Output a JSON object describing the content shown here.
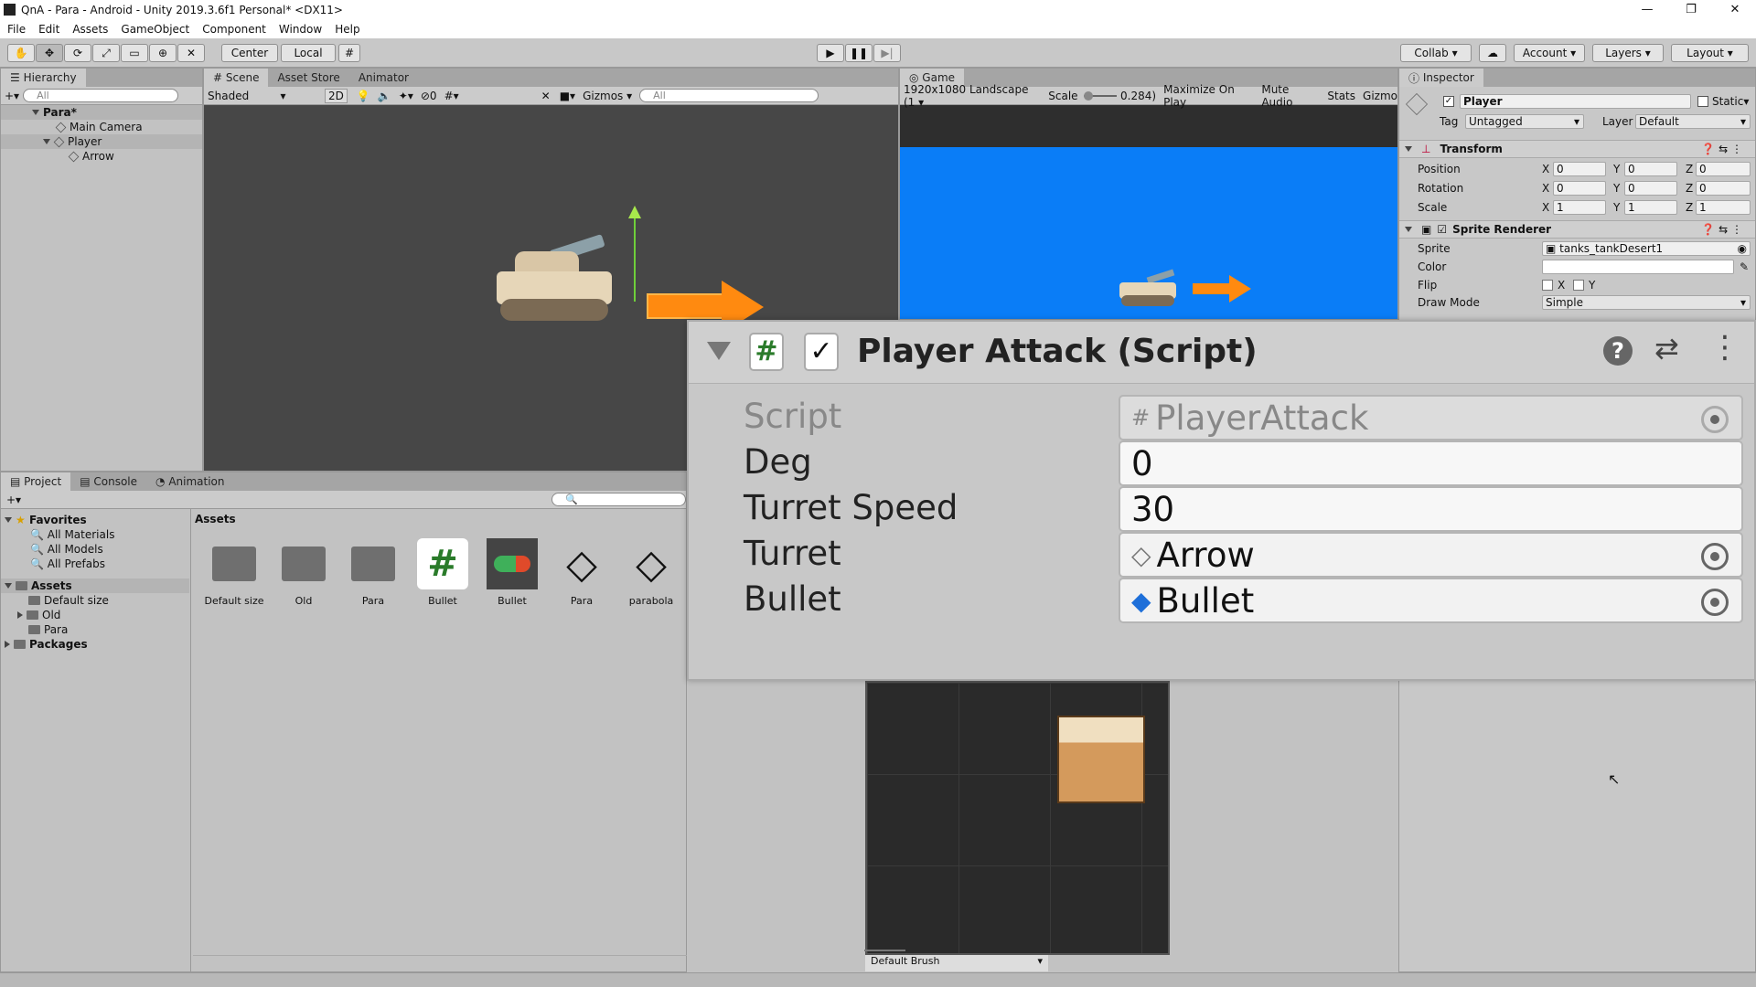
{
  "window": {
    "title": "QnA - Para - Android - Unity 2019.3.6f1 Personal* <DX11>"
  },
  "menu": [
    "File",
    "Edit",
    "Assets",
    "GameObject",
    "Component",
    "Window",
    "Help"
  ],
  "toolbar": {
    "pivot": "Center",
    "space": "Local",
    "collab": "Collab ▾",
    "account": "Account",
    "layers": "Layers",
    "layout": "Layout"
  },
  "hierarchy": {
    "tab": "Hierarchy",
    "search_placeholder": "All",
    "items": [
      "Para*",
      "Main Camera",
      "Player",
      "Arrow"
    ]
  },
  "scene": {
    "tabs": [
      "Scene",
      "Asset Store",
      "Animator"
    ],
    "shading": "Shaded",
    "mode2d": "2D",
    "hidden_count": "0",
    "gizmos": "Gizmos",
    "search_placeholder": "All"
  },
  "game": {
    "tab": "Game",
    "resolution": "1920x1080 Landscape (1",
    "scale_label": "Scale",
    "scale_value": "0.284)",
    "maximize": "Maximize On Play",
    "mute": "Mute Audio",
    "stats": "Stats",
    "gizmos": "Gizmo",
    "bg_color": "#0a7df7"
  },
  "inspector": {
    "tab": "Inspector",
    "object_name": "Player",
    "static": "Static",
    "tag_label": "Tag",
    "tag_value": "Untagged",
    "layer_label": "Layer",
    "layer_value": "Default",
    "transform": {
      "title": "Transform",
      "rows": [
        {
          "label": "Position",
          "x": "0",
          "y": "0",
          "z": "0"
        },
        {
          "label": "Rotation",
          "x": "0",
          "y": "0",
          "z": "0"
        },
        {
          "label": "Scale",
          "x": "1",
          "y": "1",
          "z": "1"
        }
      ]
    },
    "sprite_renderer": {
      "title": "Sprite Renderer",
      "sprite_label": "Sprite",
      "sprite_value": "tanks_tankDesert1",
      "color_label": "Color",
      "flip_label": "Flip",
      "flip_x": "X",
      "flip_y": "Y",
      "draw_mode_label": "Draw Mode",
      "draw_mode_value": "Simple"
    }
  },
  "player_attack": {
    "title": "Player Attack (Script)",
    "script_label": "Script",
    "script_value": "PlayerAttack",
    "deg_label": "Deg",
    "deg_value": "0",
    "turret_speed_label": "Turret Speed",
    "turret_speed_value": "30",
    "turret_label": "Turret",
    "turret_value": "Arrow",
    "bullet_label": "Bullet",
    "bullet_value": "Bullet"
  },
  "project": {
    "tabs": [
      "Project",
      "Console",
      "Animation"
    ],
    "favorites_label": "Favorites",
    "favorites": [
      "All Materials",
      "All Models",
      "All Prefabs"
    ],
    "assets_label": "Assets",
    "assets_tree": [
      "Default size",
      "Old",
      "Para"
    ],
    "packages_label": "Packages",
    "breadcrumb": "Assets",
    "grid": [
      {
        "name": "Default size",
        "icon": "folder-icon"
      },
      {
        "name": "Old",
        "icon": "folder-icon"
      },
      {
        "name": "Para",
        "icon": "folder-icon"
      },
      {
        "name": "Bullet",
        "icon": "script-icon"
      },
      {
        "name": "Bullet",
        "icon": "prefab-icon"
      },
      {
        "name": "Para",
        "icon": "unity-scene-icon"
      },
      {
        "name": "parabola",
        "icon": "unity-scene-icon"
      }
    ]
  },
  "tile_palette": {
    "brush": "Default Brush"
  }
}
